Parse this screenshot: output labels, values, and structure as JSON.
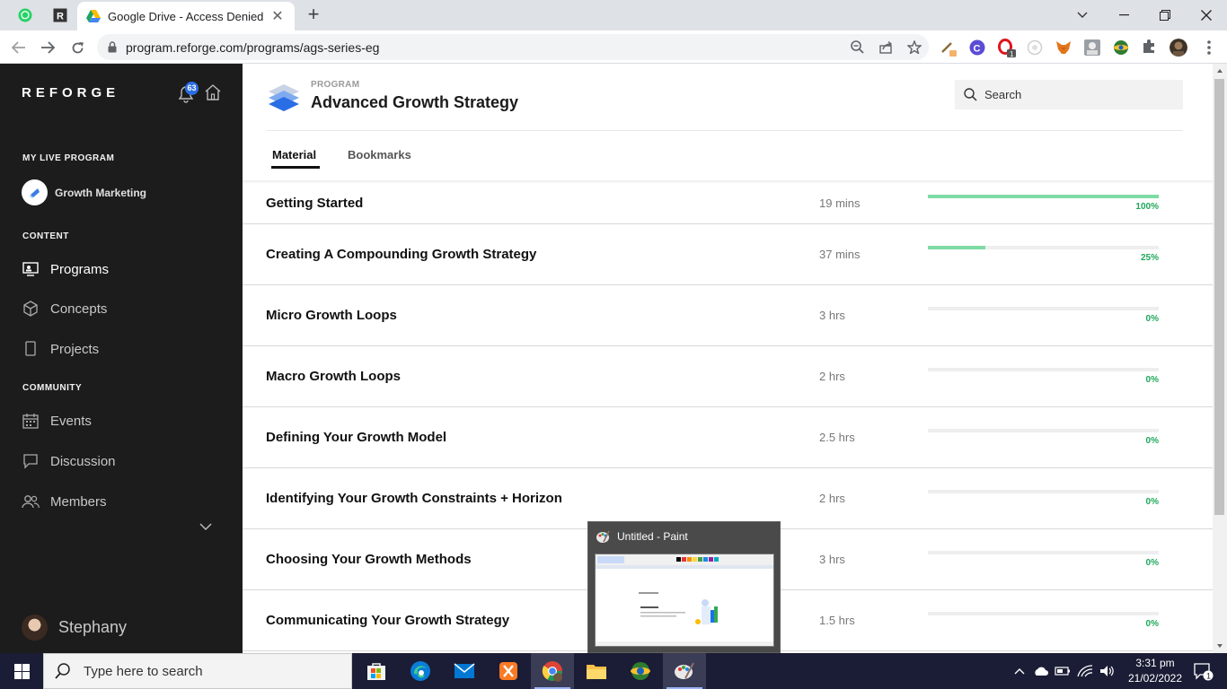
{
  "browser": {
    "tab_title": "Google Drive - Access Denied",
    "url": "program.reforge.com/programs/ags-series-eg",
    "ext_badge_1": "1"
  },
  "sidebar": {
    "logo": "REFORGE",
    "notif_count": "63",
    "my_live_program_label": "MY LIVE PROGRAM",
    "live_program": "Growth Marketing",
    "content_label": "CONTENT",
    "content_items": [
      "Programs",
      "Concepts",
      "Projects"
    ],
    "community_label": "COMMUNITY",
    "community_items": [
      "Events",
      "Discussion",
      "Members"
    ],
    "user_name": "Stephany"
  },
  "header": {
    "kicker": "PROGRAM",
    "title": "Advanced Growth Strategy",
    "search_placeholder": "Search",
    "tabs": [
      "Material",
      "Bookmarks"
    ]
  },
  "modules": [
    {
      "title": "Getting Started",
      "duration": "19 mins",
      "progress": 100,
      "progress_label": "100%"
    },
    {
      "title": "Creating A Compounding Growth Strategy",
      "duration": "37 mins",
      "progress": 25,
      "progress_label": "25%"
    },
    {
      "title": "Micro Growth Loops",
      "duration": "3 hrs",
      "progress": 0,
      "progress_label": "0%"
    },
    {
      "title": "Macro Growth Loops",
      "duration": "2 hrs",
      "progress": 0,
      "progress_label": "0%"
    },
    {
      "title": "Defining Your Growth Model",
      "duration": "2.5 hrs",
      "progress": 0,
      "progress_label": "0%"
    },
    {
      "title": "Identifying Your Growth Constraints + Horizon",
      "duration": "2 hrs",
      "progress": 0,
      "progress_label": "0%"
    },
    {
      "title": "Choosing Your Growth Methods",
      "duration": "3 hrs",
      "progress": 0,
      "progress_label": "0%"
    },
    {
      "title": "Communicating Your Growth Strategy",
      "duration": "1.5 hrs",
      "progress": 0,
      "progress_label": "0%"
    }
  ],
  "popup": {
    "title": "Untitled - Paint"
  },
  "taskbar": {
    "search_placeholder": "Type here to search",
    "time": "3:31 pm",
    "date": "21/02/2022",
    "notification_count": "1"
  },
  "colors": {
    "sidebar_bg": "#1c1c1c",
    "progress_fill": "#7edba4",
    "progress_text": "#1fa85a",
    "badge": "#2a6ee6",
    "taskbar_bg": "#1b1d36"
  }
}
